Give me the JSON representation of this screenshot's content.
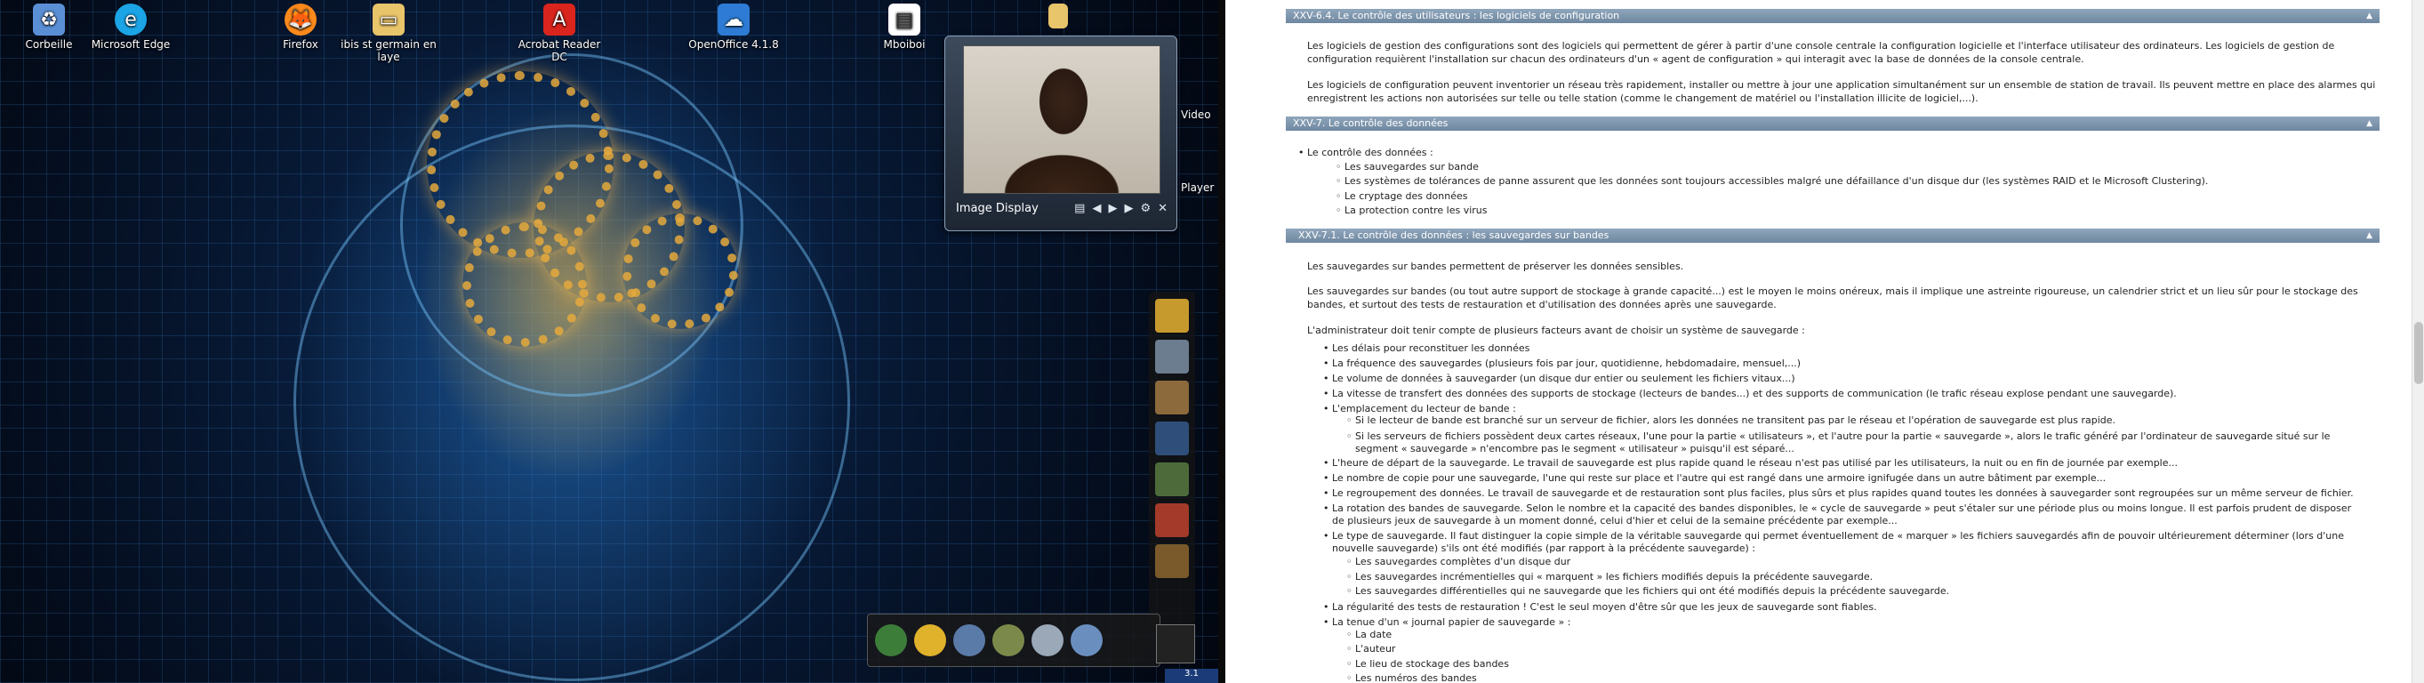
{
  "desktop": {
    "icons": [
      {
        "label": "Corbeille",
        "glyph": "recycle-bin-icon",
        "color": "#5a8fd6"
      },
      {
        "label": "Microsoft Edge",
        "glyph": "edge-icon",
        "color": "#1ba4e6"
      },
      {
        "label": "Firefox",
        "glyph": "firefox-icon",
        "color": "#ff8a1c"
      },
      {
        "label": "ibis st germain en laye",
        "glyph": "folder-icon",
        "color": "#e8c46a"
      },
      {
        "label": "Acrobat Reader DC",
        "glyph": "acrobat-icon",
        "color": "#d9251d"
      },
      {
        "label": "OpenOffice 4.1.8",
        "glyph": "openoffice-icon",
        "color": "#2d7bd4"
      },
      {
        "label": "Mboiboi",
        "glyph": "document-icon",
        "color": "#ffffff"
      }
    ],
    "partial_labels": {
      "video": "Video",
      "player": "Player"
    },
    "image_display": {
      "caption": "Image Display"
    },
    "taskbar_corner": "3.1"
  },
  "document": {
    "sections": {
      "s1": "XXV-6.4. Le contrôle des utilisateurs : les logiciels de configuration",
      "s2": "XXV-7. Le contrôle des données",
      "s3": "XXV-7.1. Le contrôle des données : les sauvegardes sur bandes"
    },
    "p1": "Les logiciels de gestion des configurations sont des logiciels qui permettent de gérer à partir d'une console centrale la configuration logicielle et l'interface utilisateur des ordinateurs. Les logiciels de gestion de configuration requièrent l'installation sur chacun des ordinateurs d'un « agent de configuration » qui interagit avec la base de données de la console centrale.",
    "p2": "Les logiciels de configuration peuvent inventorier un réseau très rapidement, installer ou mettre à jour une application simultanément sur un ensemble de station de travail. Ils peuvent mettre en place des alarmes qui enregistrent les actions non autorisées sur telle ou telle station (comme le changement de matériel ou l'installation illicite de logiciel,...).",
    "controle": {
      "head": "Le contrôle des données :",
      "items": [
        "Les sauvegardes sur bande",
        "Les systèmes de tolérances de panne assurent que les données sont toujours accessibles malgré une défaillance d'un disque dur (les systèmes RAID et le Microsoft Clustering).",
        "Le cryptage des données",
        "La protection contre les virus"
      ]
    },
    "p3": "Les sauvegardes sur bandes permettent de préserver les données sensibles.",
    "p4": "Les sauvegardes sur bandes (ou tout autre support de stockage à grande capacité...) est le moyen le moins onéreux, mais il implique une astreinte rigoureuse, un calendrier strict et un lieu sûr pour le stockage des bandes, et surtout des tests de restauration et d'utilisation des données après une sauvegarde.",
    "p5": "L'administrateur doit tenir compte de plusieurs facteurs avant de choisir un système de sauvegarde :",
    "factors": [
      "Les délais pour reconstituer les données",
      "La fréquence des sauvegardes (plusieurs fois par jour, quotidienne, hebdomadaire, mensuel,...)",
      "Le volume de données à sauvegarder (un disque dur entier ou seulement les fichiers vitaux...)",
      "La vitesse de transfert des données des supports de stockage (lecteurs de bandes...) et des supports de communication (le trafic réseau explose pendant une sauvegarde).",
      "L'emplacement du lecteur de bande :"
    ],
    "emplacement": [
      "Si le lecteur de bande est branché sur un serveur de fichier, alors les données ne transitent pas par le réseau et l'opération de sauvegarde est plus rapide.",
      "Si les serveurs de fichiers possèdent deux cartes réseaux, l'une pour la partie « utilisateurs », et l'autre pour la partie « sauvegarde », alors le trafic généré par l'ordinateur de sauvegarde situé sur le segment « sauvegarde » n'encombre pas le segment « utilisateur » puisqu'il est séparé..."
    ],
    "factors2": [
      "L'heure de départ de la sauvegarde. Le travail de sauvegarde est plus rapide quand le réseau n'est pas utilisé par les utilisateurs, la nuit ou en fin de journée par exemple...",
      "Le nombre de copie pour une sauvegarde, l'une qui reste sur place et l'autre qui est rangé dans une armoire ignifugée dans un autre bâtiment par exemple...",
      "Le regroupement des données. Le travail de sauvegarde et de restauration sont plus faciles, plus sûrs et plus rapides quand toutes les données à sauvegarder sont regroupées sur un même serveur de fichier.",
      "La rotation des bandes de sauvegarde. Selon le nombre et la capacité des bandes disponibles, le « cycle de sauvegarde » peut s'étaler sur une période plus ou moins longue. Il est parfois prudent de disposer de plusieurs jeux de sauvegarde à un moment donné, celui d'hier et celui de la semaine précédente par exemple...",
      "Le type de sauvegarde. Il faut distinguer la copie simple de la véritable sauvegarde qui permet éventuellement de « marquer » les fichiers sauvegardés afin de pouvoir ultérieurement déterminer (lors d'une nouvelle sauvegarde) s'ils ont été modifiés (par rapport à la précédente sauvegarde) :"
    ],
    "types": [
      "Les sauvegardes complètes d'un disque dur",
      "Les sauvegardes incrémentielles qui « marquent » les fichiers modifiés depuis la précédente sauvegarde.",
      "Les sauvegardes différentielles qui ne sauvegarde que les fichiers qui ont été modifiés depuis la précédente sauvegarde."
    ],
    "factors3": [
      "La régularité des tests de restauration ! C'est le seul moyen d'être sûr que les jeux de sauvegarde sont fiables.",
      "La tenue d'un « journal papier de sauvegarde » :"
    ],
    "journal": [
      "La date",
      "L'auteur",
      "Le lieu de stockage des bandes",
      "Les numéros des bandes"
    ],
    "toggle": "▲"
  }
}
